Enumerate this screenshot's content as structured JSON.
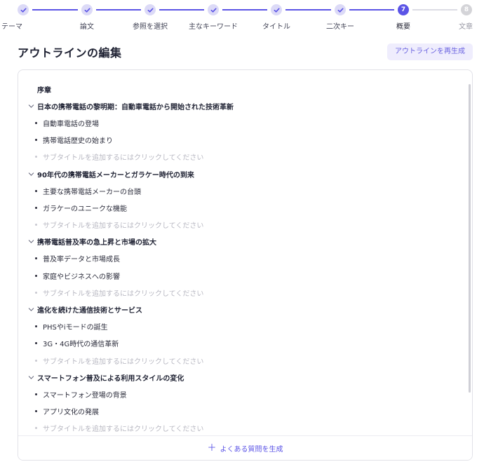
{
  "stepper": {
    "steps": [
      {
        "label": "テーマ",
        "state": "done"
      },
      {
        "label": "論文",
        "state": "done"
      },
      {
        "label": "参照を選択",
        "state": "done"
      },
      {
        "label": "主なキーワード",
        "state": "done"
      },
      {
        "label": "タイトル",
        "state": "done"
      },
      {
        "label": "二次キー",
        "state": "done"
      },
      {
        "label": "概要",
        "state": "current",
        "number": "7"
      },
      {
        "label": "文章",
        "state": "pending",
        "number": "8"
      }
    ]
  },
  "header": {
    "title": "アウトラインの編集",
    "regenerate_label": "アウトラインを再生成"
  },
  "outline": {
    "preface": "序章",
    "placeholder": "サブタイトルを追加するにはクリックしてください",
    "chapters": [
      {
        "title": "日本の携帯電話の黎明期：自動車電話から開始された技術革新",
        "subs": [
          "自動車電話の登場",
          "携帯電話歴史の始まり"
        ]
      },
      {
        "title": "90年代の携帯電話メーカーとガラケー時代の到来",
        "subs": [
          "主要な携帯電話メーカーの台頭",
          "ガラケーのユニークな機能"
        ]
      },
      {
        "title": "携帯電話普及率の急上昇と市場の拡大",
        "subs": [
          "普及率データと市場成長",
          "家庭やビジネスへの影響"
        ]
      },
      {
        "title": "進化を続けた通信技術とサービス",
        "subs": [
          "PHSやiモードの誕生",
          "3G・4G時代の通信革新"
        ]
      },
      {
        "title": "スマートフォン普及による利用スタイルの変化",
        "subs": [
          "スマートフォン登場の背景",
          "アプリ文化の発展"
        ]
      }
    ]
  },
  "footer": {
    "faq_label": "よくある質問を生成"
  },
  "colors": {
    "accent": "#5b54e6",
    "accent_light": "#dcdaf7",
    "button_bg": "#efedfd"
  }
}
